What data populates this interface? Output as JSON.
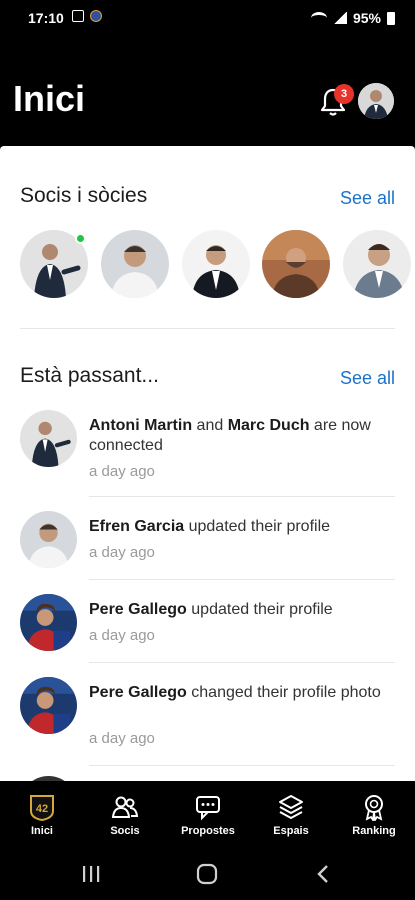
{
  "status_bar": {
    "time": "17:10",
    "battery": "95%"
  },
  "header": {
    "title": "Inici",
    "notification_count": "3"
  },
  "members_section": {
    "title": "Socis i sòcies",
    "see_all": "See all"
  },
  "activity_section": {
    "title": "Està passant...",
    "see_all": "See all",
    "items": [
      {
        "name1": "Antoni Martin",
        "mid": " and ",
        "name2": "Marc Duch",
        "rest": " are now connected",
        "time": "a day ago"
      },
      {
        "name1": "Efren Garcia",
        "rest": " updated their profile",
        "time": "a day ago"
      },
      {
        "name1": "Pere Gallego",
        "rest": " updated their profile",
        "time": "a day ago"
      },
      {
        "name1": "Pere Gallego",
        "rest": " changed their profile photo",
        "time": "a day ago"
      }
    ]
  },
  "bottom_nav": {
    "items": [
      {
        "label": "Inici",
        "icon": "logo-42-icon"
      },
      {
        "label": "Socis",
        "icon": "people-icon"
      },
      {
        "label": "Propostes",
        "icon": "chat-bubble-icon"
      },
      {
        "label": "Espais",
        "icon": "layers-icon"
      },
      {
        "label": "Ranking",
        "icon": "medal-icon"
      }
    ],
    "logo_text": "42"
  },
  "colors": {
    "accent": "#1a73c8",
    "badge": "#e8332c",
    "online": "#22c444"
  }
}
